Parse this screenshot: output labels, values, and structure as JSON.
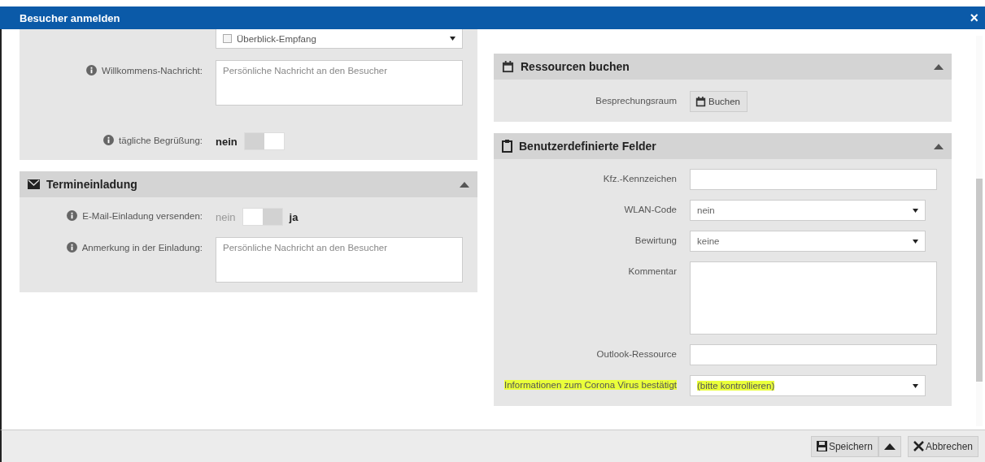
{
  "dialog": {
    "title": "Besucher anmelden",
    "close": "×"
  },
  "left_sections": [
    {
      "rows": [
        {
          "kind": "multiselect",
          "item": "Überblick-Empfang",
          "checked": false
        },
        {
          "kind": "textarea",
          "label": "Willkommens-Nachricht:",
          "info": true,
          "placeholder": "Persönliche Nachricht an den Besucher"
        },
        {
          "kind": "toggle",
          "label": "tägliche Begrüßung:",
          "info": true,
          "off_label": "nein",
          "on": false
        }
      ]
    },
    {
      "title": "Termineinladung",
      "rows": [
        {
          "kind": "toggle",
          "label": "E-Mail-Einladung versenden:",
          "info": true,
          "off_label": "nein",
          "on_label": "ja",
          "on": true
        },
        {
          "kind": "textarea",
          "label": "Anmerkung in der Einladung:",
          "info": true,
          "placeholder": "Persönliche Nachricht an den Besucher"
        }
      ]
    }
  ],
  "right_sections": [
    {
      "title": "Ressourcen buchen",
      "rows": [
        {
          "kind": "button",
          "label": "Besprechungsraum",
          "button": "Buchen"
        }
      ]
    },
    {
      "title": "Benutzerdefinierte Felder",
      "rows": [
        {
          "kind": "text",
          "label": "Kfz.-Kennzeichen"
        },
        {
          "kind": "select",
          "label": "WLAN-Code",
          "value": "nein"
        },
        {
          "kind": "select",
          "label": "Bewirtung",
          "value": "keine"
        },
        {
          "kind": "textarea",
          "label": "Kommentar"
        },
        {
          "kind": "text",
          "label": "Outlook-Ressource"
        },
        {
          "kind": "select",
          "label": "Informationen zum Corona Virus bestätigt",
          "value": "(bitte kontrollieren)",
          "highlighted": true
        }
      ]
    }
  ],
  "footer": {
    "buttons": [
      {
        "kind": "save",
        "label": "Speichern"
      },
      {
        "kind": "caret"
      },
      {
        "kind": "cancel",
        "label": "Abbrechen"
      }
    ]
  }
}
